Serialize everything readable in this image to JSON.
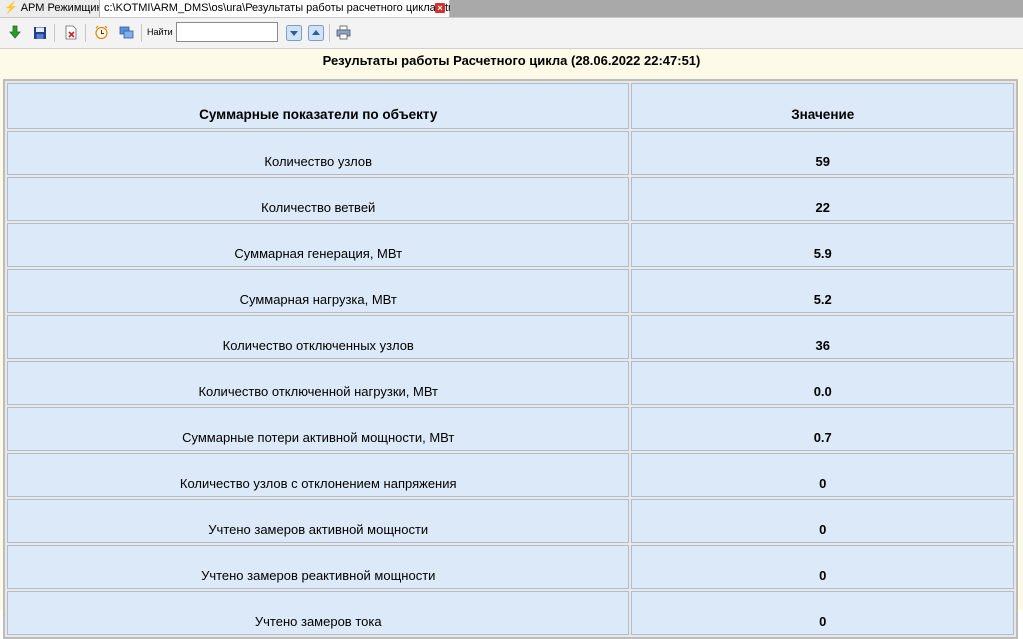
{
  "tabs": {
    "app_label": "АРМ Режимщика",
    "active_label": "c:\\KOTMI\\ARM_DMS\\os\\ura\\Результаты работы расчетного цикла.html"
  },
  "toolbar": {
    "find_label": "Найти",
    "find_value": "",
    "icons": [
      "download-icon",
      "save-icon",
      "delete-file-icon",
      "schedule-icon",
      "refresh-icon",
      "find-next-down-icon",
      "find-previous-up-icon",
      "print-icon"
    ]
  },
  "report": {
    "title": "Результаты работы Расчетного цикла (28.06.2022 22:47:51)",
    "headers": [
      "Суммарные показатели по объекту",
      "Значение"
    ],
    "rows": [
      {
        "label": "Количество узлов",
        "value": "59"
      },
      {
        "label": "Количество ветвей",
        "value": "22"
      },
      {
        "label": "Суммарная генерация, МВт",
        "value": "5.9"
      },
      {
        "label": "Суммарная нагрузка, МВт",
        "value": "5.2"
      },
      {
        "label": "Количество отключенных узлов",
        "value": "36"
      },
      {
        "label": "Количество отключенной нагрузки, МВт",
        "value": "0.0"
      },
      {
        "label": "Суммарные потери активной мощности, МВт",
        "value": "0.7"
      },
      {
        "label": "Количество узлов с отклонением напряжения",
        "value": "0"
      },
      {
        "label": "Учтено замеров активной мощности",
        "value": "0"
      },
      {
        "label": "Учтено замеров реактивной мощности",
        "value": "0"
      },
      {
        "label": "Учтено замеров тока",
        "value": "0"
      }
    ]
  }
}
